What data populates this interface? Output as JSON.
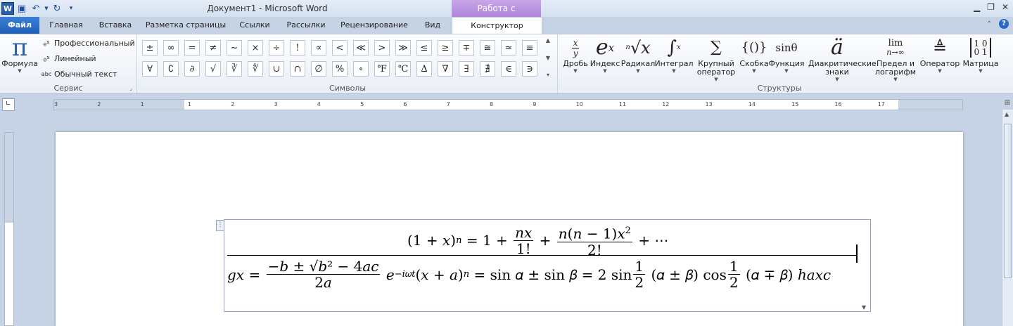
{
  "window": {
    "title": "Документ1  -  Microsoft Word",
    "context_tab": "Работа с формулами"
  },
  "tabs": [
    {
      "label": "Файл"
    },
    {
      "label": "Главная"
    },
    {
      "label": "Вставка"
    },
    {
      "label": "Разметка страницы"
    },
    {
      "label": "Ссылки"
    },
    {
      "label": "Рассылки"
    },
    {
      "label": "Рецензирование"
    },
    {
      "label": "Вид"
    },
    {
      "label": "Конструктор"
    }
  ],
  "ribbon": {
    "service": {
      "label": "Сервис",
      "formula_button": "Формула",
      "professional": "Профессиональный",
      "linear": "Линейный",
      "plain_text": "Обычный текст"
    },
    "symbols": {
      "label": "Символы",
      "row1": [
        "±",
        "∞",
        "=",
        "≠",
        "~",
        "×",
        "÷",
        "!",
        "∝",
        "<",
        "≪",
        ">",
        "≫",
        "≤",
        "≥",
        "∓",
        "≅",
        "≈",
        "≡"
      ],
      "row2": [
        "∀",
        "∁",
        "∂",
        "√",
        "∛",
        "∜",
        "∪",
        "∩",
        "∅",
        "%",
        "∘",
        "℉",
        "℃",
        "∆",
        "∇",
        "∃",
        "∄",
        "∈",
        "∋"
      ]
    },
    "structures": {
      "label": "Структуры",
      "buttons": [
        {
          "label": "Дробь",
          "icon": "fraction-icon"
        },
        {
          "label": "Индекс",
          "icon": "script-icon"
        },
        {
          "label": "Радикал",
          "icon": "radical-icon"
        },
        {
          "label": "Интеграл",
          "icon": "integral-icon"
        },
        {
          "label": "Крупный оператор",
          "icon": "large-operator-icon"
        },
        {
          "label": "Скобка",
          "icon": "bracket-icon"
        },
        {
          "label": "Функция",
          "icon": "function-icon"
        },
        {
          "label": "Диакритические знаки",
          "icon": "accent-icon"
        },
        {
          "label": "Предел и логарифм",
          "icon": "limit-icon"
        },
        {
          "label": "Оператор",
          "icon": "operator-icon"
        },
        {
          "label": "Матрица",
          "icon": "matrix-icon"
        }
      ]
    }
  },
  "ruler": {
    "h_labels": [
      "3",
      "2",
      "1",
      "1",
      "2",
      "3",
      "4",
      "5",
      "6",
      "7",
      "8",
      "9",
      "10",
      "11",
      "12",
      "13",
      "14",
      "15",
      "16",
      "17"
    ]
  },
  "equation": {
    "line1": {
      "a": "(1 + 𝑥)",
      "a_sup": "𝑛",
      "b": " = 1 + ",
      "f1_num": "𝑛𝑥",
      "f1_den": "1!",
      "c": " + ",
      "f2_num": "𝑛(𝑛 − 1)𝑥",
      "f2_num_sup": "2",
      "f2_den": "2!",
      "d": " + ⋯"
    },
    "line2": {
      "a": "𝑔𝑥 = ",
      "f1_num": "−𝑏 ± √𝑏² − 4𝑎𝑐",
      "f1_den": "2𝑎",
      "b": " 𝑒",
      "b_sup": "−𝑖𝜔𝑡",
      "c": "(𝑥 + 𝑎)",
      "c_sup": "𝑛",
      "d": " = sin 𝛼 ± sin 𝛽 = 2 sin",
      "f2_num": "1",
      "f2_den": "2",
      "e": " (𝛼 ± 𝛽) cos",
      "f3_num": "1",
      "f3_den": "2",
      "f": " (𝛼 ∓ 𝛽) ℎ𝑎𝑥𝑐"
    }
  }
}
